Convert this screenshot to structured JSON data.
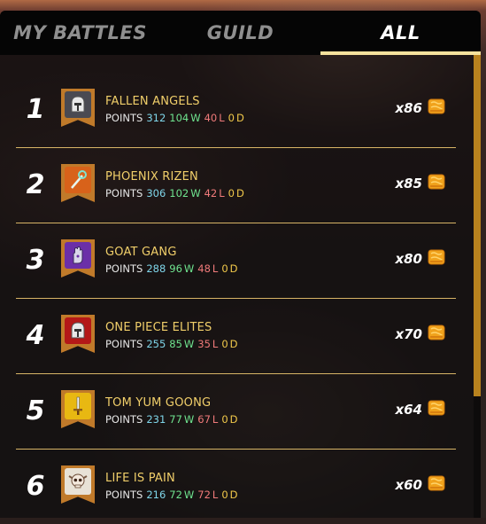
{
  "tabs": [
    {
      "label": "MY BATTLES",
      "active": false
    },
    {
      "label": "GUILD",
      "active": false
    },
    {
      "label": "ALL",
      "active": true
    }
  ],
  "stat_labels": {
    "points": "POINTS",
    "wins": "W",
    "losses": "L",
    "draws": "D"
  },
  "guilds": [
    {
      "rank": "1",
      "name": "FALLEN ANGELS",
      "points": "312",
      "wins": "104",
      "losses": "40",
      "draws": "0",
      "multiplier": "x86",
      "banner_color": "#4a4a52",
      "emblem": "helmet-icon"
    },
    {
      "rank": "2",
      "name": "PHOENIX RIZEN",
      "points": "306",
      "wins": "102",
      "losses": "42",
      "draws": "0",
      "multiplier": "x85",
      "banner_color": "#d8621a",
      "emblem": "staff-icon"
    },
    {
      "rank": "3",
      "name": "GOAT GANG",
      "points": "288",
      "wins": "96",
      "losses": "48",
      "draws": "0",
      "multiplier": "x80",
      "banner_color": "#6b2fa8",
      "emblem": "hand-icon"
    },
    {
      "rank": "4",
      "name": "ONE PIECE ELITES",
      "points": "255",
      "wins": "85",
      "losses": "35",
      "draws": "0",
      "multiplier": "x70",
      "banner_color": "#b41818",
      "emblem": "helmet-icon"
    },
    {
      "rank": "5",
      "name": "TOM YUM GOONG",
      "points": "231",
      "wins": "77",
      "losses": "67",
      "draws": "0",
      "multiplier": "x64",
      "banner_color": "#e8b812",
      "emblem": "sword-icon"
    },
    {
      "rank": "6",
      "name": "LIFE IS PAIN",
      "points": "216",
      "wins": "72",
      "losses": "72",
      "draws": "0",
      "multiplier": "x60",
      "banner_color": "#e8e2d6",
      "emblem": "skull-icon"
    }
  ],
  "colors": {
    "accent": "#f6e29d",
    "name": "#f1cf6a",
    "points": "#7fd6ea",
    "wins": "#6fe48f",
    "losses": "#f07a7a",
    "draws": "#f0c84a"
  }
}
